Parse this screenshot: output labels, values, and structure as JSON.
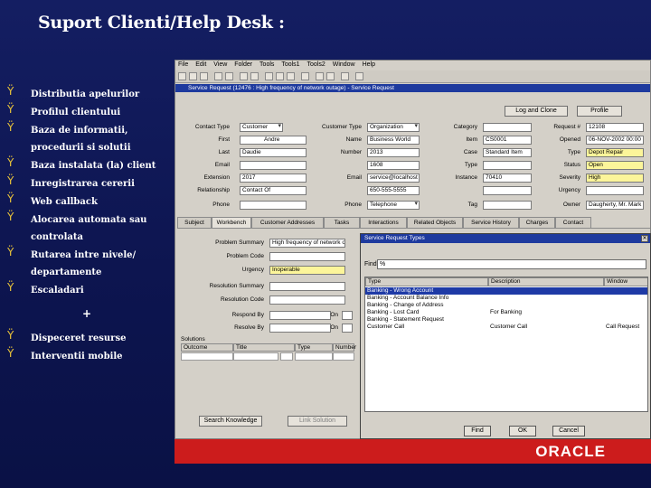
{
  "slide": {
    "title": "Suport Clienti/Help Desk :",
    "bullet_glyph": "Ÿ",
    "bullets": [
      "Distributia apelurilor",
      "Profilul clientului",
      "Baza de informatii, procedurii si solutii",
      "Baza instalata (la) client",
      "Inregistrarea cererii",
      "Web callback",
      "Alocarea automata sau controlata",
      "Rutarea intre nivele/ departamente",
      "Escaladari"
    ],
    "plus": "+",
    "bullets2": [
      "Dispeceret resurse",
      "Interventii mobile"
    ]
  },
  "app": {
    "menu": [
      "File",
      "Edit",
      "View",
      "Folder",
      "Tools",
      "Tools1",
      "Tools2",
      "Window",
      "Help"
    ],
    "form_title": "Service Request (12476 : High frequency of network outage) - Service Request",
    "buttons": {
      "log_full": "Log and Clone",
      "prefs": "Profile"
    },
    "labels": {
      "contact_type": "Contact Type",
      "first": "First",
      "last": "Last",
      "email": "Email",
      "extension": "Extension",
      "relationship": "Relationship",
      "phone": "Phone",
      "customer_type": "Customer Type",
      "name": "Name",
      "number": "Number",
      "email2": "Email",
      "instance": "Instance",
      "phone2": "Phone",
      "category": "Category",
      "item": "Item",
      "case": "Case",
      "type": "Type",
      "severity": "Severity",
      "owner": "Owner",
      "request": "Request #",
      "opened": "Opened",
      "status": "Status",
      "urgency": "Urgency",
      "tag": "Tag"
    },
    "values": {
      "contact_type": "Customer",
      "first": "Andre",
      "last": "Daudie",
      "extension": "2017",
      "relationship": "Contact Of",
      "customer_type": "Organization",
      "name": "Business World",
      "number": "2013",
      "ext2": "1608",
      "email2": "service@localhost",
      "phone2": "650-555-5555",
      "phone_type": "Telephone",
      "item": "CS0001",
      "case_value": "Standard Item",
      "instance": "70410",
      "request_no": "12108",
      "opened": "06-NOV-2002 00:00",
      "type": "Depot Repair",
      "status": "Open",
      "severity": "High",
      "owner": "Daugherty, Mr. Mark"
    },
    "tabs": [
      "Subject",
      "Workbench",
      "Customer Addresses",
      "Tasks",
      "Interactions",
      "Related Objects",
      "Service History",
      "Charges",
      "Contact"
    ],
    "workbench": {
      "problem_summary_label": "Problem Summary",
      "problem_summary": "High frequency of network outage",
      "problem_code_label": "Problem Code",
      "urgency_label": "Urgency",
      "urgency": "Inoperable",
      "resolution_summary_label": "Resolution Summary",
      "resolution_code_label": "Resolution Code",
      "respond_by_label": "Respond By",
      "resolve_by_label": "Resolve By",
      "on_label": "On",
      "solutions_label": "Solutions",
      "grid_headers": [
        "Outcome",
        "Title",
        "Type",
        "Number"
      ],
      "search_knowledge": "Search Knowledge",
      "link_solution": "Link Solution"
    }
  },
  "dialog": {
    "title": "Service Request Types",
    "find_label": "Find",
    "find_value": "%",
    "headers": [
      "Type",
      "Description",
      "Window"
    ],
    "rows": [
      {
        "type": "Banking - Wrong Account",
        "description": "",
        "window": ""
      },
      {
        "type": "Banking - Account Balance Info",
        "description": "",
        "window": ""
      },
      {
        "type": "Banking - Change of Address",
        "description": "",
        "window": ""
      },
      {
        "type": "Banking - Lost Card",
        "description": "For Banking",
        "window": ""
      },
      {
        "type": "Banking - Statement Request",
        "description": "",
        "window": ""
      },
      {
        "type": "Customer Call",
        "description": "Customer Call",
        "window": "Call Request"
      }
    ],
    "buttons": {
      "find": "Find",
      "ok": "OK",
      "cancel": "Cancel"
    }
  },
  "brand": {
    "logo": "ORACLE",
    "accent": "#cc1c1c"
  }
}
